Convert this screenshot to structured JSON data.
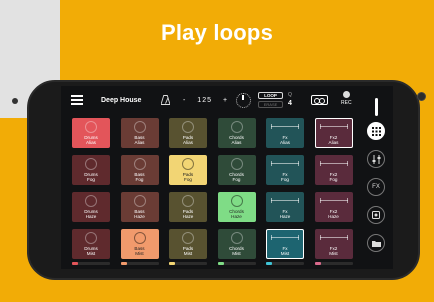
{
  "headline": "Play loops",
  "topbar": {
    "menu_icon": "menu-icon",
    "title": "Deep House",
    "metronome_icon": "metronome-icon",
    "bpm_minus": "-",
    "bpm": "125",
    "bpm_plus": "+",
    "loop_label": "LOOP",
    "loop_sub": "ERASE",
    "q_label": "Q",
    "q_value": "4",
    "tape_icon": "cassette-icon",
    "rec_label": "REC"
  },
  "pads": [
    [
      {
        "name": "Drums",
        "sub": "Alias",
        "color": "#e3555a",
        "active": false
      },
      {
        "name": "Bass",
        "sub": "Alias",
        "color": "#6a3c35",
        "active": false
      },
      {
        "name": "Pads",
        "sub": "Alias",
        "color": "#585230",
        "active": false
      },
      {
        "name": "Chords",
        "sub": "Alias",
        "color": "#2f4b39",
        "active": false
      },
      {
        "name": "Fx",
        "sub": "Alias",
        "color": "#225458",
        "active": false
      },
      {
        "name": "Fx2",
        "sub": "Alias",
        "color": "#5a2b3c",
        "active": true
      }
    ],
    [
      {
        "name": "Drums",
        "sub": "Fog",
        "color": "#5f2a2d",
        "active": false
      },
      {
        "name": "Bass",
        "sub": "Fog",
        "color": "#6a3c35",
        "active": false
      },
      {
        "name": "Pads",
        "sub": "Fog",
        "color": "#f2d574",
        "active": false,
        "bright": true
      },
      {
        "name": "Chords",
        "sub": "Fog",
        "color": "#2f4b39",
        "active": false
      },
      {
        "name": "Fx",
        "sub": "Fog",
        "color": "#225458",
        "active": false
      },
      {
        "name": "Fx2",
        "sub": "Fog",
        "color": "#5a2b3c",
        "active": false
      }
    ],
    [
      {
        "name": "Drums",
        "sub": "Haze",
        "color": "#5f2a2d",
        "active": false
      },
      {
        "name": "Bass",
        "sub": "Haze",
        "color": "#6a3c35",
        "active": false
      },
      {
        "name": "Pads",
        "sub": "Haze",
        "color": "#585230",
        "active": false
      },
      {
        "name": "Chords",
        "sub": "Haze",
        "color": "#7fdc86",
        "active": false,
        "bright": true
      },
      {
        "name": "Fx",
        "sub": "Haze",
        "color": "#225458",
        "active": false
      },
      {
        "name": "Fx2",
        "sub": "Haze",
        "color": "#5a2b3c",
        "active": false
      }
    ],
    [
      {
        "name": "Drums",
        "sub": "Mist",
        "color": "#5f2a2d",
        "active": false
      },
      {
        "name": "Bass",
        "sub": "Mist",
        "color": "#f19a6c",
        "active": false,
        "bright": true
      },
      {
        "name": "Pads",
        "sub": "Mist",
        "color": "#585230",
        "active": false
      },
      {
        "name": "Chords",
        "sub": "Mist",
        "color": "#2f4b39",
        "active": false
      },
      {
        "name": "Fx",
        "sub": "Mist",
        "color": "#1d6470",
        "active": true
      },
      {
        "name": "Fx2",
        "sub": "Mist",
        "color": "#5a2b3c",
        "active": false
      }
    ]
  ],
  "column_colors": [
    "#e3555a",
    "#f19a6c",
    "#f2d574",
    "#7fdc86",
    "#3fc4d6",
    "#d96a8c"
  ],
  "side": {
    "buttons": [
      "grid-icon",
      "mixer-icon",
      "fx-icon",
      "sampler-icon",
      "folder-icon"
    ],
    "fx_label": "FX"
  }
}
